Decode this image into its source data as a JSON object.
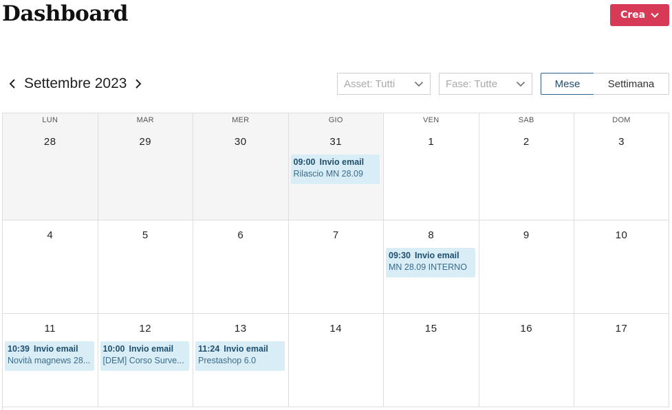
{
  "header": {
    "title": "Dashboard",
    "create_label": "Crea"
  },
  "calendar_nav": {
    "month_label": "Settembre 2023"
  },
  "filters": {
    "asset_label": "Asset: Tutti",
    "fase_label": "Fase: Tutte"
  },
  "views": {
    "month_label": "Mese",
    "week_label": "Settimana",
    "active": "Mese"
  },
  "colors": {
    "accent": "#d63a56",
    "event_bg": "#d9edf6",
    "event_text": "#1f4f6e",
    "active_view_border": "#2f5f86"
  },
  "weekdays": [
    "LUN",
    "MAR",
    "MER",
    "GIO",
    "VEN",
    "SAB",
    "DOM"
  ],
  "weeks": [
    {
      "days": [
        {
          "num": "28",
          "other": true
        },
        {
          "num": "29",
          "other": true
        },
        {
          "num": "30",
          "other": true
        },
        {
          "num": "31",
          "other": true,
          "event": {
            "time": "09:00",
            "type": "Invio email",
            "title": "Rilascio MN 28.09"
          }
        },
        {
          "num": "1"
        },
        {
          "num": "2"
        },
        {
          "num": "3"
        }
      ]
    },
    {
      "days": [
        {
          "num": "4"
        },
        {
          "num": "5"
        },
        {
          "num": "6"
        },
        {
          "num": "7"
        },
        {
          "num": "8",
          "event": {
            "time": "09:30",
            "type": "Invio email",
            "title": "MN 28.09 INTERNO"
          }
        },
        {
          "num": "9"
        },
        {
          "num": "10"
        }
      ]
    },
    {
      "days": [
        {
          "num": "11",
          "event": {
            "time": "10:39",
            "type": "Invio email",
            "title": "Novità magnews 28..."
          }
        },
        {
          "num": "12",
          "event": {
            "time": "10:00",
            "type": "Invio email",
            "title": "[DEM] Corso Surve..."
          }
        },
        {
          "num": "13",
          "event": {
            "time": "11:24",
            "type": "Invio email",
            "title": "Prestashop 6.0"
          }
        },
        {
          "num": "14"
        },
        {
          "num": "15"
        },
        {
          "num": "16"
        },
        {
          "num": "17"
        }
      ]
    }
  ]
}
